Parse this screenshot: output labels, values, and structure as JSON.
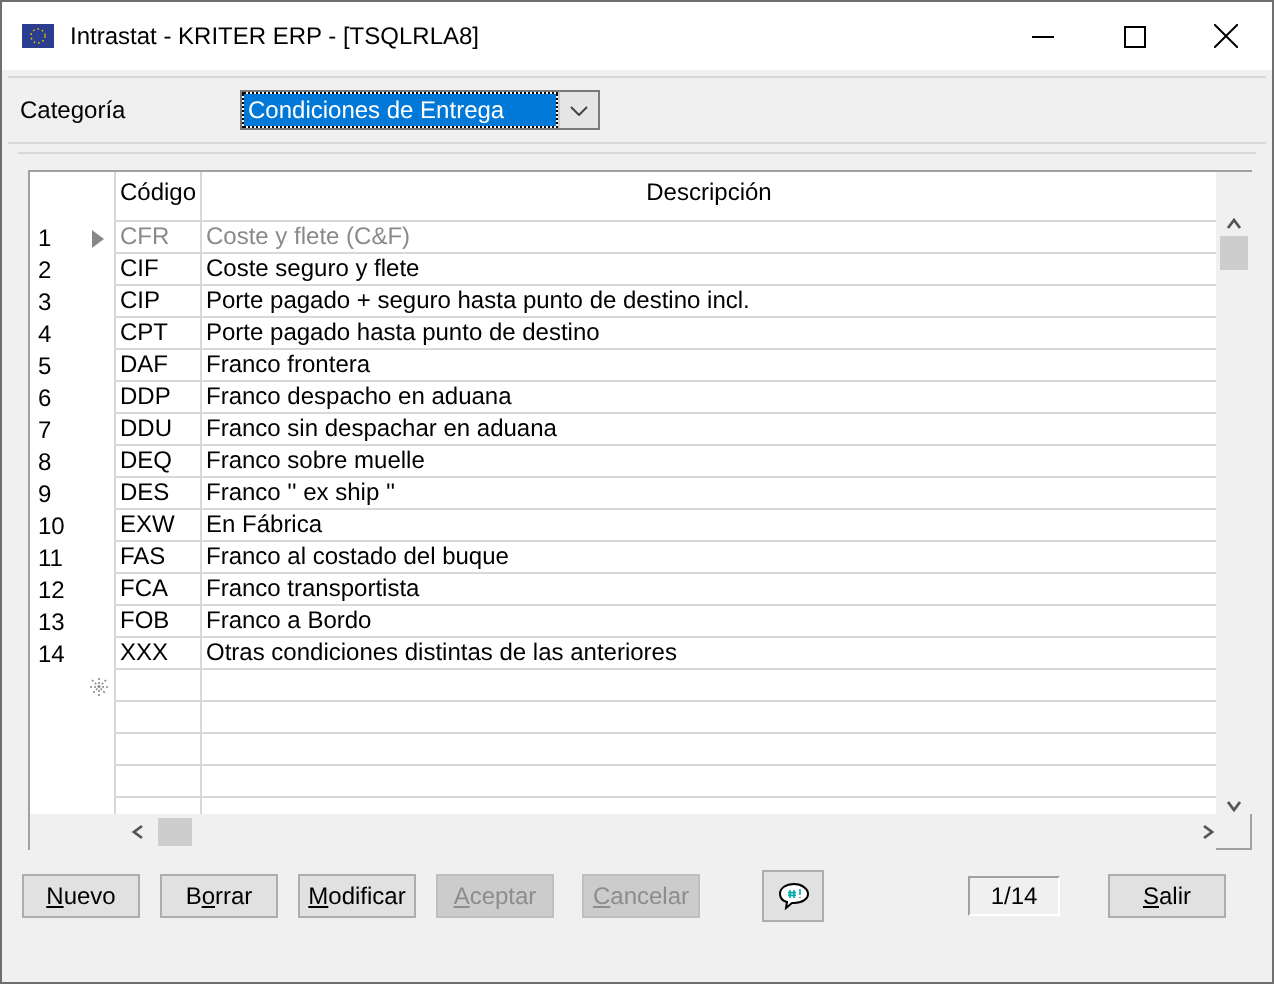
{
  "window": {
    "title": "Intrastat - KRITER ERP - [TSQLRLA8]"
  },
  "category": {
    "label": "Categoría",
    "value": "Condiciones de Entrega"
  },
  "table": {
    "columns": [
      "Código",
      "Descripción"
    ],
    "rows": [
      {
        "number": "1",
        "code": "CFR",
        "description": "Coste y flete (C&F)",
        "selected": true
      },
      {
        "number": "2",
        "code": "CIF",
        "description": "Coste seguro y flete",
        "selected": false
      },
      {
        "number": "3",
        "code": "CIP",
        "description": "Porte pagado + seguro hasta punto de destino incl.",
        "selected": false
      },
      {
        "number": "4",
        "code": "CPT",
        "description": "Porte pagado hasta punto de destino",
        "selected": false
      },
      {
        "number": "5",
        "code": "DAF",
        "description": "Franco frontera",
        "selected": false
      },
      {
        "number": "6",
        "code": "DDP",
        "description": "Franco despacho en aduana",
        "selected": false
      },
      {
        "number": "7",
        "code": "DDU",
        "description": "Franco sin despachar en aduana",
        "selected": false
      },
      {
        "number": "8",
        "code": "DEQ",
        "description": "Franco sobre muelle",
        "selected": false
      },
      {
        "number": "9",
        "code": "DES",
        "description": "Franco '' ex ship ''",
        "selected": false
      },
      {
        "number": "10",
        "code": "EXW",
        "description": "En Fábrica",
        "selected": false
      },
      {
        "number": "11",
        "code": "FAS",
        "description": "Franco al costado del buque",
        "selected": false
      },
      {
        "number": "12",
        "code": "FCA",
        "description": "Franco transportista",
        "selected": false
      },
      {
        "number": "13",
        "code": "FOB",
        "description": "Franco a Bordo",
        "selected": false
      },
      {
        "number": "14",
        "code": "XXX",
        "description": "Otras condiciones distintas de las anteriores",
        "selected": false
      }
    ]
  },
  "buttons": [
    {
      "kind": "text",
      "key": "N",
      "post": "uevo",
      "disabled": false
    },
    {
      "kind": "text",
      "pre": "B",
      "key": "o",
      "post": "rrar",
      "disabled": false
    },
    {
      "kind": "text",
      "key": "M",
      "post": "odificar",
      "disabled": false
    },
    {
      "kind": "text",
      "key": "A",
      "post": "ceptar",
      "disabled": true
    },
    {
      "kind": "text",
      "key": "C",
      "post": "ancelar",
      "disabled": true
    },
    {
      "kind": "comment",
      "disabled": false
    },
    {
      "kind": "counter",
      "text": "1/14"
    },
    {
      "kind": "text",
      "key": "S",
      "post": "alir",
      "disabled": false
    }
  ]
}
